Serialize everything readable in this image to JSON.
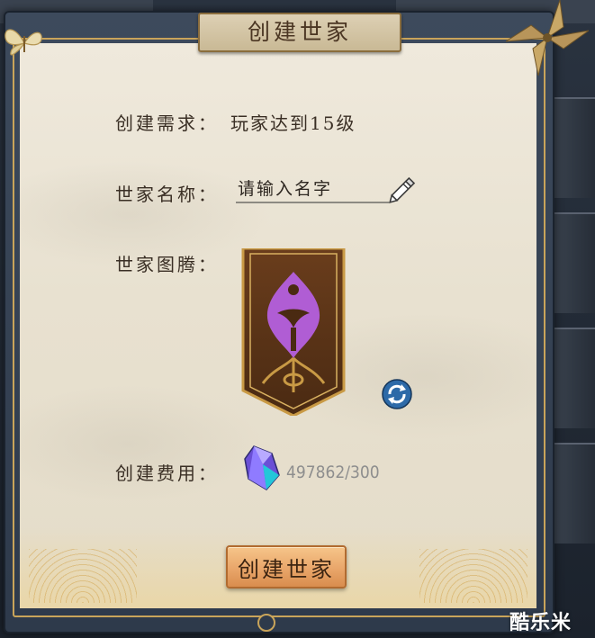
{
  "dialog": {
    "title": "创建世家"
  },
  "form": {
    "requirement_label": "创建需求：",
    "requirement_value": "玩家达到15级",
    "name_label": "世家名称：",
    "name_placeholder": "请输入名字",
    "totem_label": "世家图腾：",
    "cost_label": "创建费用：",
    "cost_value": "497862/300"
  },
  "actions": {
    "create_button_label": "创建世家"
  },
  "icons": {
    "edit": "pencil-icon",
    "refresh": "refresh-icon",
    "currency": "crystal-icon",
    "decor_left": "butterfly-icon",
    "decor_right": "pinwheel-icon"
  },
  "colors": {
    "parchment": "#ece5d5",
    "gold_trim": "#c9a45a",
    "frame": "#34404f",
    "button": "#e9a66a",
    "emblem_purple": "#b160d6",
    "cost_gray": "#8e8e8e"
  },
  "watermark": "酷乐米"
}
